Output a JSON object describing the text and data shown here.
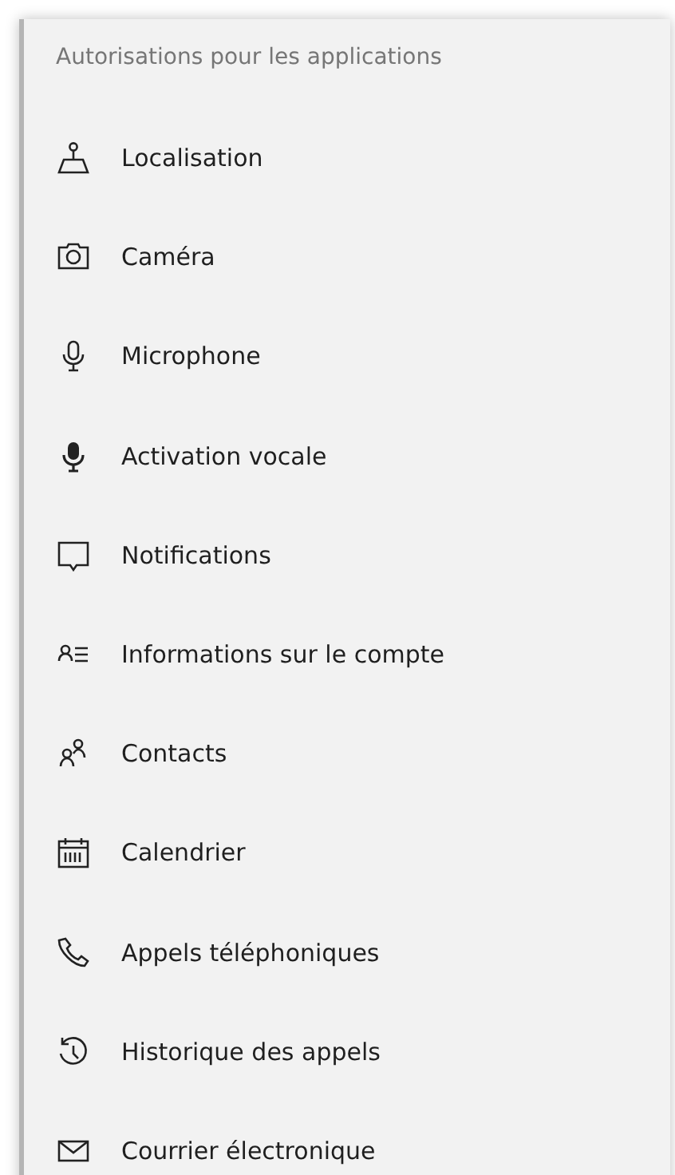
{
  "section_title": "Autorisations pour les applications",
  "items": [
    {
      "label": "Localisation"
    },
    {
      "label": "Caméra"
    },
    {
      "label": "Microphone"
    },
    {
      "label": "Activation vocale"
    },
    {
      "label": "Notifications"
    },
    {
      "label": "Informations sur le compte"
    },
    {
      "label": "Contacts"
    },
    {
      "label": "Calendrier"
    },
    {
      "label": "Appels téléphoniques"
    },
    {
      "label": "Historique des appels"
    },
    {
      "label": "Courrier électronique"
    }
  ]
}
